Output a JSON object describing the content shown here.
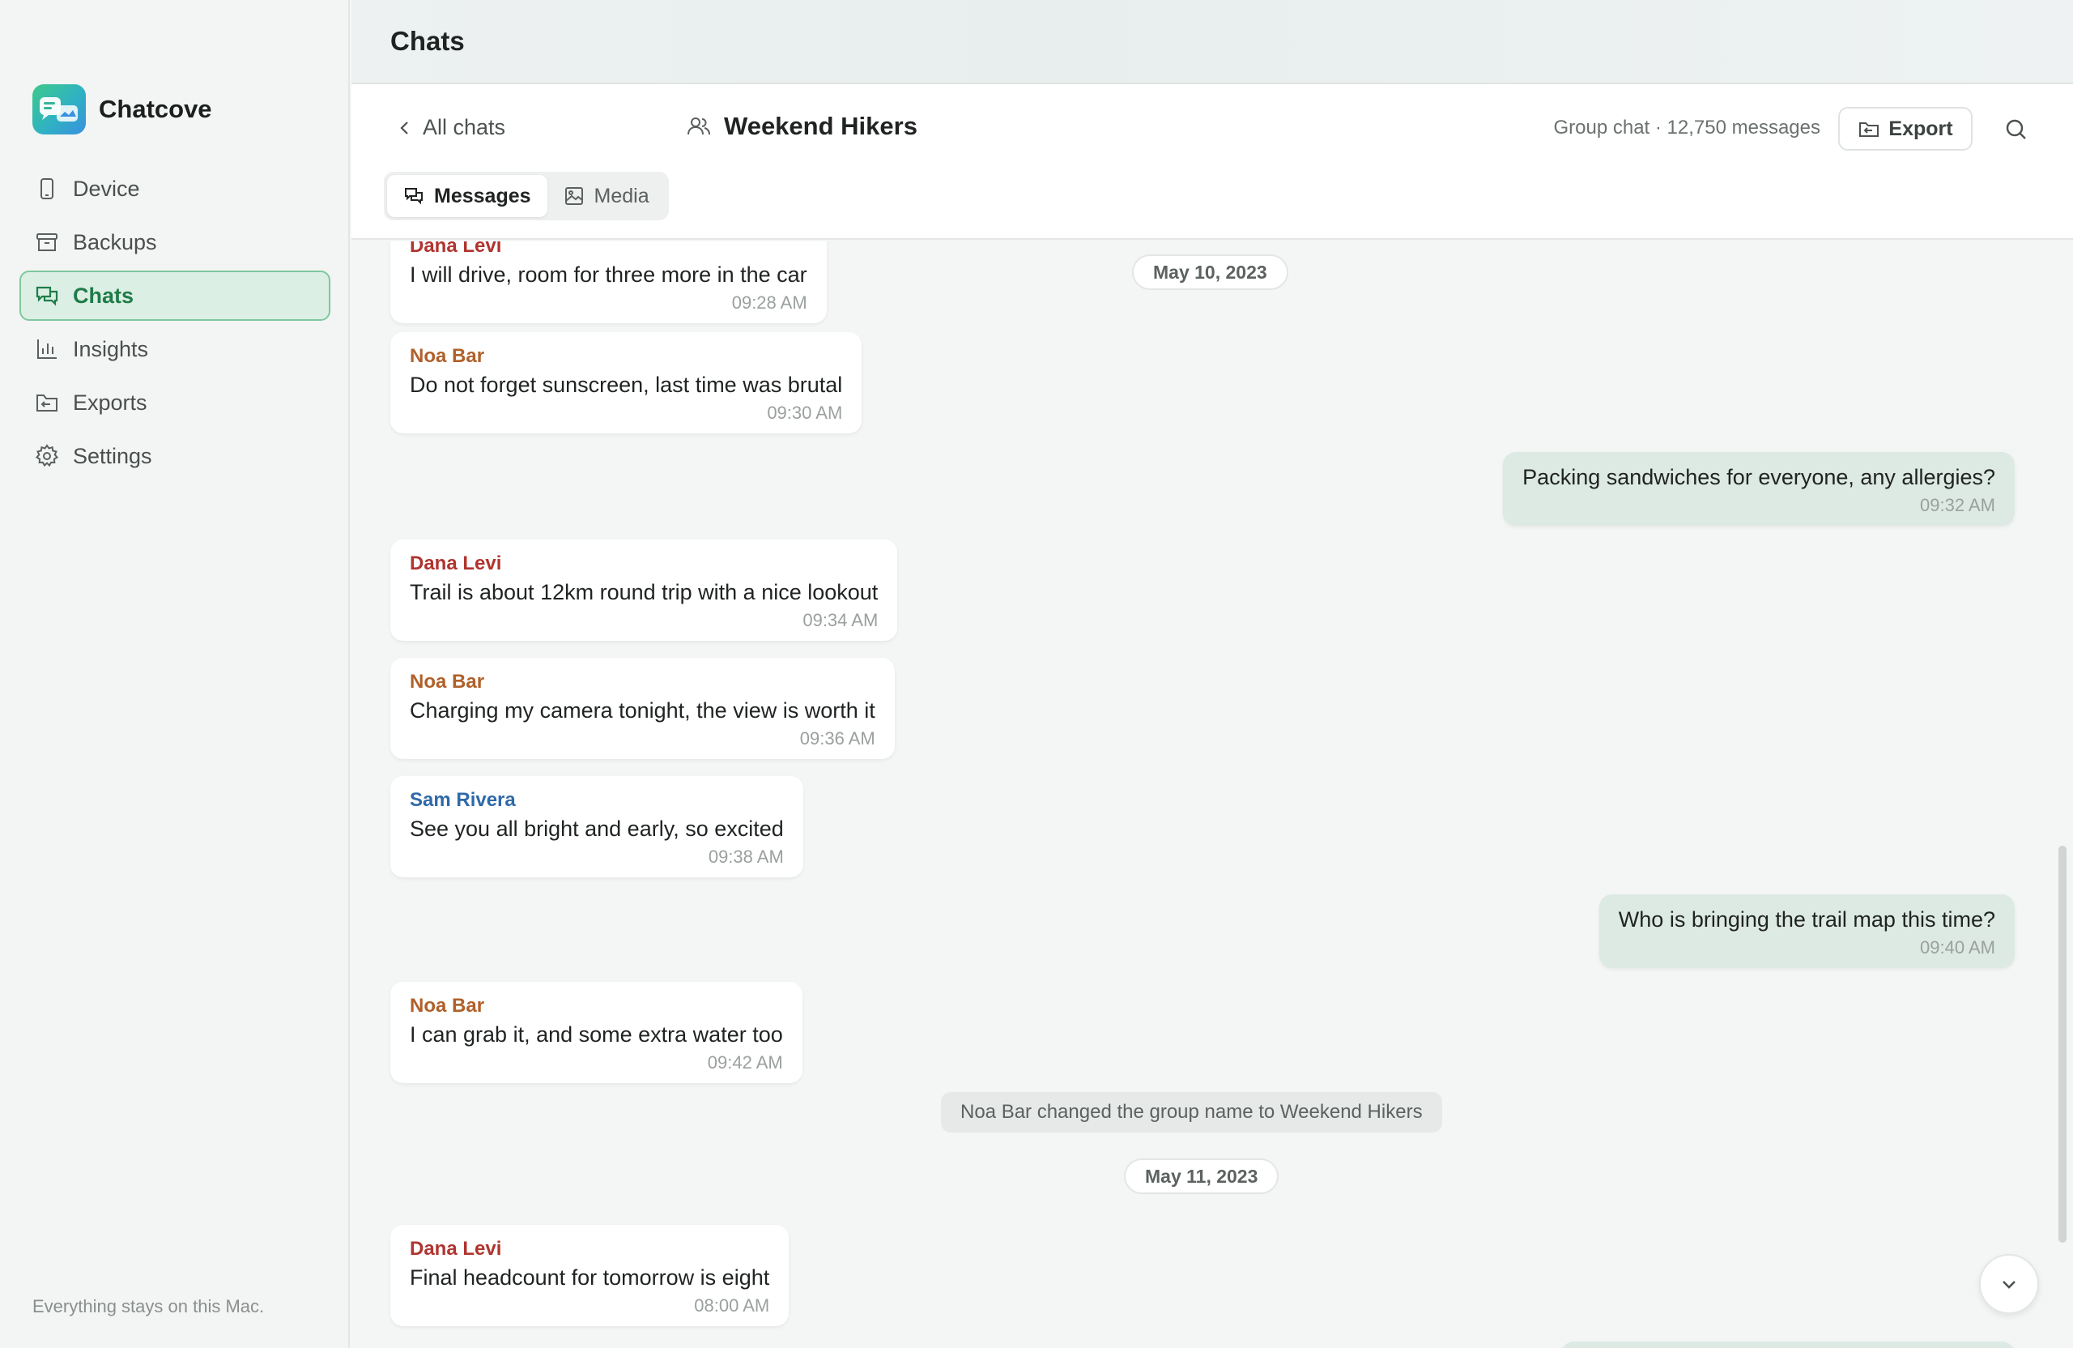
{
  "app": {
    "name": "Chatcove",
    "footer": "Everything stays on this Mac."
  },
  "sidebar": {
    "items": [
      {
        "label": "Device",
        "icon": "phone-icon"
      },
      {
        "label": "Backups",
        "icon": "archive-icon"
      },
      {
        "label": "Chats",
        "icon": "chat-bubbles-icon",
        "active": true
      },
      {
        "label": "Insights",
        "icon": "bar-chart-icon"
      },
      {
        "label": "Exports",
        "icon": "export-icon"
      },
      {
        "label": "Settings",
        "icon": "gear-icon"
      }
    ]
  },
  "page": {
    "title": "Chats"
  },
  "chat": {
    "back_label": "All chats",
    "title": "Weekend Hikers",
    "meta": "Group chat · 12,750 messages",
    "export_label": "Export",
    "tabs": [
      {
        "label": "Messages",
        "active": true
      },
      {
        "label": "Media",
        "active": false
      }
    ]
  },
  "messages": {
    "date_1": "May 10, 2023",
    "date_2": "May 11, 2023",
    "system_1": "Noa Bar changed the group name to Weekend Hikers",
    "items": [
      {
        "sender": "Dana Levi",
        "text": "I will drive, room for three more in the car",
        "time": "09:28 AM"
      },
      {
        "sender": "Noa Bar",
        "text": "Do not forget sunscreen, last time was brutal",
        "time": "09:30 AM"
      },
      {
        "sender": "",
        "text": "Packing sandwiches for everyone, any allergies?",
        "time": "09:32 AM"
      },
      {
        "sender": "Dana Levi",
        "text": "Trail is about 12km round trip with a nice lookout",
        "time": "09:34 AM"
      },
      {
        "sender": "Noa Bar",
        "text": "Charging my camera tonight, the view is worth it",
        "time": "09:36 AM"
      },
      {
        "sender": "Sam Rivera",
        "text": "See you all bright and early, so excited",
        "time": "09:38 AM"
      },
      {
        "sender": "",
        "text": "Who is bringing the trail map this time?",
        "time": "09:40 AM"
      },
      {
        "sender": "Noa Bar",
        "text": "I can grab it, and some extra water too",
        "time": "09:42 AM"
      },
      {
        "sender": "Dana Levi",
        "text": "Final headcount for tomorrow is eight",
        "time": "08:00 AM"
      }
    ]
  },
  "colors": {
    "accent": "#1f7c48",
    "accent_bg": "#dcefe4",
    "outgoing_bubble": "#dde9e3",
    "sender_dana": "#b0342f",
    "sender_noa": "#b0602a",
    "sender_sam": "#2f69a8"
  }
}
